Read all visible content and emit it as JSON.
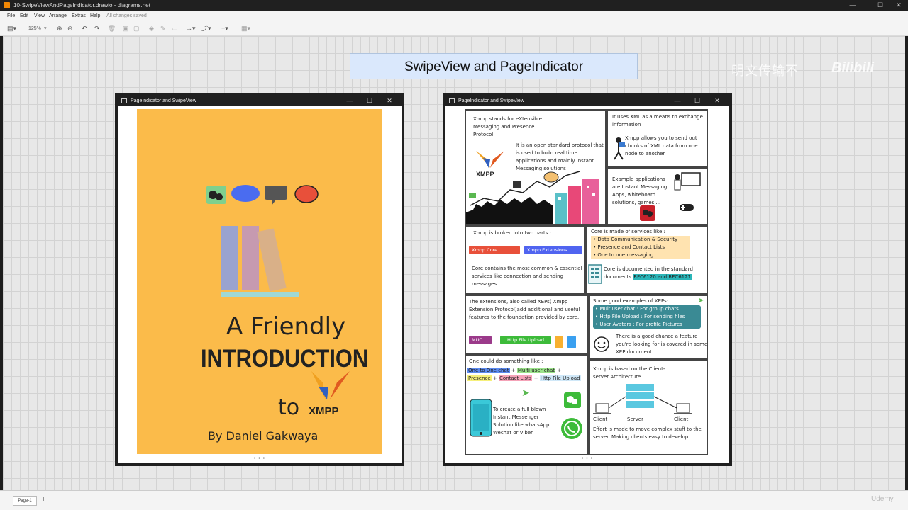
{
  "app": {
    "title": "10-SwipeViewAndPageIndicator.drawio - diagrams.net",
    "window_controls": [
      "—",
      "☐",
      "✕"
    ]
  },
  "menu": {
    "items": [
      "File",
      "Edit",
      "View",
      "Arrange",
      "Extras",
      "Help"
    ],
    "status": "All changes saved"
  },
  "toolbar": {
    "zoom": "125%"
  },
  "watermark": {
    "text1": "明文传输不",
    "text2": "Bilibili"
  },
  "diagram": {
    "header": "SwipeView and PageIndicator",
    "window1": {
      "title": "PageIndicator and SwipeView",
      "book": {
        "title_line1": "A Friendly",
        "title_line2": "INTRODUCTION",
        "title_line3": "to",
        "brand": "XMPP",
        "author": "By Daniel Gakwaya"
      },
      "page_dots": "• • •"
    },
    "window2": {
      "title": "PageIndicator and SwipeView",
      "page_dots": "• • •",
      "panels": {
        "p1_intro": "Xmpp stands for eXtensible Messaging and Presence Protocol",
        "p1_body": "It is an open standard protocol that is used to build real time applications and mainly Instant Messaging solutions",
        "p1_brand": "XMPP",
        "p2_line1": "It uses XML as a means to exchange information",
        "p2_line2": "Xmpp allows you to send out chunks of XML data from one node to another",
        "p3_text": "Example applications are Instant Messaging Apps, whiteboard solutions, games ...",
        "p4_intro": "Xmpp is broken into two parts :",
        "p4_tag1": "Xmpp Core",
        "p4_tag2": "Xmpp Extensions",
        "p4_body": "Core contains the most common & essential services like connection and sending messages",
        "p5_intro": "Core is made of services like :",
        "p5_items": [
          "Data Communication & Security",
          "Presence and Contact Lists",
          "One to one messaging"
        ],
        "p5_doc": "Core is documented in the standard documents",
        "p5_rfc": "RFC6120 and RFC6121",
        "p6_text": "The extensions, also called XEPs( Xmpp Extension Protocol)add additional and useful features to the foundation provided by core.",
        "p6_tag1": "MUC",
        "p6_tag2": "Http File Upload",
        "p7_intro": "Some good examples of XEPs:",
        "p7_items": [
          "Multiuser chat : For group chats",
          "Http File Upload : For sending files",
          "User Avatars : For profile Pictures"
        ],
        "p7_note": "There is a good chance a feature you're looking for is covered in some XEP document",
        "p8_intro": "One could do something like :",
        "p8_h1": "One to One chat",
        "p8_h2": "Multi user chat",
        "p8_h3": "Presence",
        "p8_h4": "Contact Lists",
        "p8_h5": "Http File Upload",
        "p8_plus": "+",
        "p8_body": "To create a full blown Instant Messenger Solution like whatsApp, Wechat or Viber",
        "p9_intro": "Xmpp is based on the Client-server Architecture",
        "p9_client_left": "Client",
        "p9_server": "Server",
        "p9_client_right": "Client",
        "p9_body": "Effort is made to move complex stuff to the server. Making clients easy to develop"
      }
    }
  },
  "bottom": {
    "page_tab": "Page-1",
    "add": "+",
    "watermark": "Udemy"
  },
  "colors": {
    "canvas": "#e8e8e8",
    "header_fill": "#dae8fc",
    "book_cover": "#fbbb4a",
    "tag_red": "#e8503a",
    "tag_blue": "#5064f0",
    "tag_purple": "#9b3a8a",
    "tag_green": "#3dbb3a",
    "teal": "#3a8a94"
  }
}
